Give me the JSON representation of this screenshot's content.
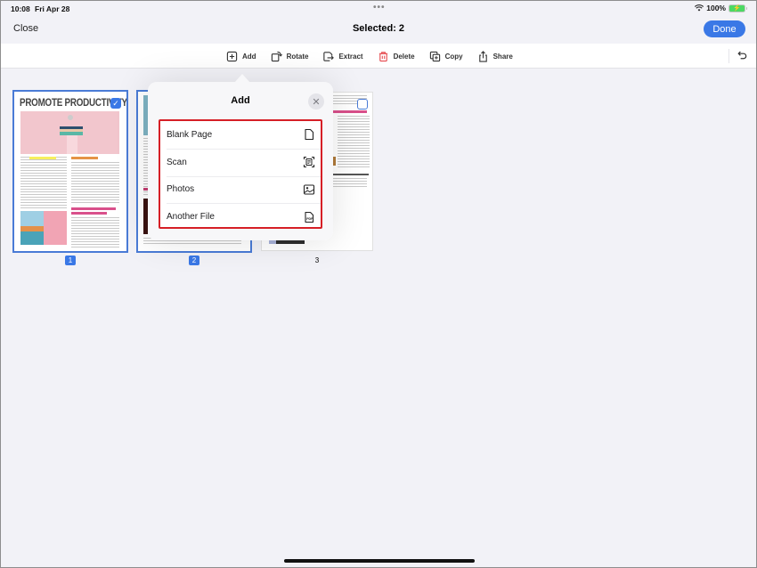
{
  "status_bar": {
    "time": "10:08",
    "date": "Fri Apr 28",
    "battery_percent": "100%",
    "wifi_icon": "wifi-icon",
    "battery_icon": "battery-charging-icon"
  },
  "nav": {
    "close_label": "Close",
    "title": "Selected: 2",
    "done_label": "Done",
    "accent_color": "#3a78e6"
  },
  "toolbar": {
    "items": [
      {
        "label": "Add",
        "icon": "add-page-icon"
      },
      {
        "label": "Rotate",
        "icon": "rotate-icon"
      },
      {
        "label": "Extract",
        "icon": "extract-icon"
      },
      {
        "label": "Delete",
        "icon": "trash-icon",
        "color": "#e5484d"
      },
      {
        "label": "Copy",
        "icon": "copy-icon"
      },
      {
        "label": "Share",
        "icon": "share-icon"
      }
    ],
    "undo_icon": "undo-icon"
  },
  "pages": [
    {
      "number": "1",
      "selected": true,
      "title": "PROMOTE PRODUCTIVITY"
    },
    {
      "number": "2",
      "selected": true
    },
    {
      "number": "3",
      "selected": false
    }
  ],
  "popover": {
    "title": "Add",
    "close_icon": "close-icon",
    "highlight_color": "#d61f26",
    "items": [
      {
        "label": "Blank Page",
        "icon": "blank-page-icon"
      },
      {
        "label": "Scan",
        "icon": "scan-icon"
      },
      {
        "label": "Photos",
        "icon": "photo-icon"
      },
      {
        "label": "Another File",
        "icon": "pdf-file-icon"
      }
    ]
  }
}
